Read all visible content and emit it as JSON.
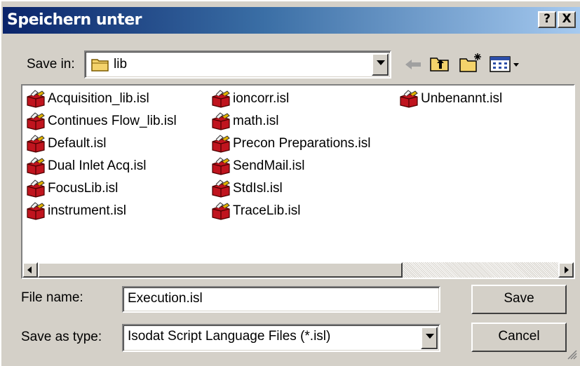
{
  "window": {
    "title": "Speichern unter"
  },
  "titlebar_buttons": {
    "help": "?",
    "close": "X"
  },
  "save_in": {
    "label": "Save in:",
    "value": "lib"
  },
  "files": {
    "col1": [
      "Acquisition_lib.isl",
      "Continues Flow_lib.isl",
      "Default.isl",
      "Dual Inlet Acq.isl",
      "FocusLib.isl",
      "instrument.isl"
    ],
    "col2": [
      "ioncorr.isl",
      "math.isl",
      "Precon Preparations.isl",
      "SendMail.isl",
      "StdIsl.isl",
      "TraceLib.isl"
    ],
    "col3": [
      "Unbenannt.isl"
    ]
  },
  "file_name": {
    "label": "File name:",
    "value": "Execution.isl"
  },
  "save_as_type": {
    "label": "Save as type:",
    "value": "Isodat Script Language Files (*.isl)"
  },
  "buttons": {
    "save": "Save",
    "cancel": "Cancel"
  },
  "icons": {
    "file": "toolbox-script-icon",
    "folder": "folder-icon",
    "back": "back-arrow-icon",
    "up": "up-folder-icon",
    "new_folder": "new-folder-icon",
    "view": "view-menu-icon"
  },
  "colors": {
    "title_start": "#0a246a",
    "title_end": "#a6caf0",
    "dialog_bg": "#d4d0c8"
  }
}
